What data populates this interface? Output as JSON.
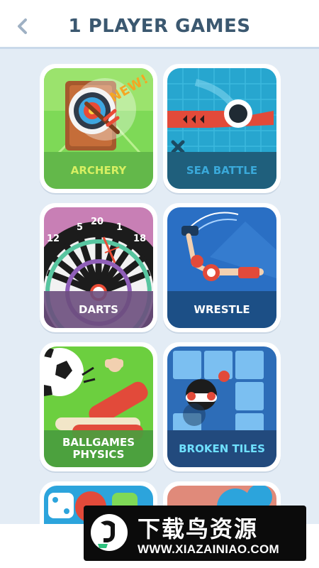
{
  "header": {
    "title": "1 PLAYER GAMES",
    "back_icon": "chevron-left-icon"
  },
  "games": [
    {
      "label": "ARCHERY",
      "badge": "NEW!",
      "label_color": "#d7ef62",
      "label_bg": "#63b84a"
    },
    {
      "label": "SEA BATTLE",
      "label_color": "#3aa9da",
      "label_bg": "#1f5f7c"
    },
    {
      "label": "DARTS",
      "label_color": "#ffffff",
      "label_bg": "#6b4e7d"
    },
    {
      "label": "WRESTLE",
      "label_color": "#ffffff",
      "label_bg": "#1c4f86"
    },
    {
      "label": "BALLGAMES PHYSICS",
      "label_color": "#ffffff",
      "label_bg": "#4a9d3e"
    },
    {
      "label": "BROKEN TILES",
      "label_color": "#6fe0ff",
      "label_bg": "#224a7d"
    }
  ],
  "darts_numbers": [
    "5",
    "20",
    "1",
    "12",
    "18"
  ],
  "watermark": {
    "cn_text": "下载鸟资源",
    "url": "WWW.XIAZAINIAO.COM"
  },
  "colors": {
    "background": "#e3ecf5",
    "title": "#3b5870",
    "card": "#ffffff"
  }
}
